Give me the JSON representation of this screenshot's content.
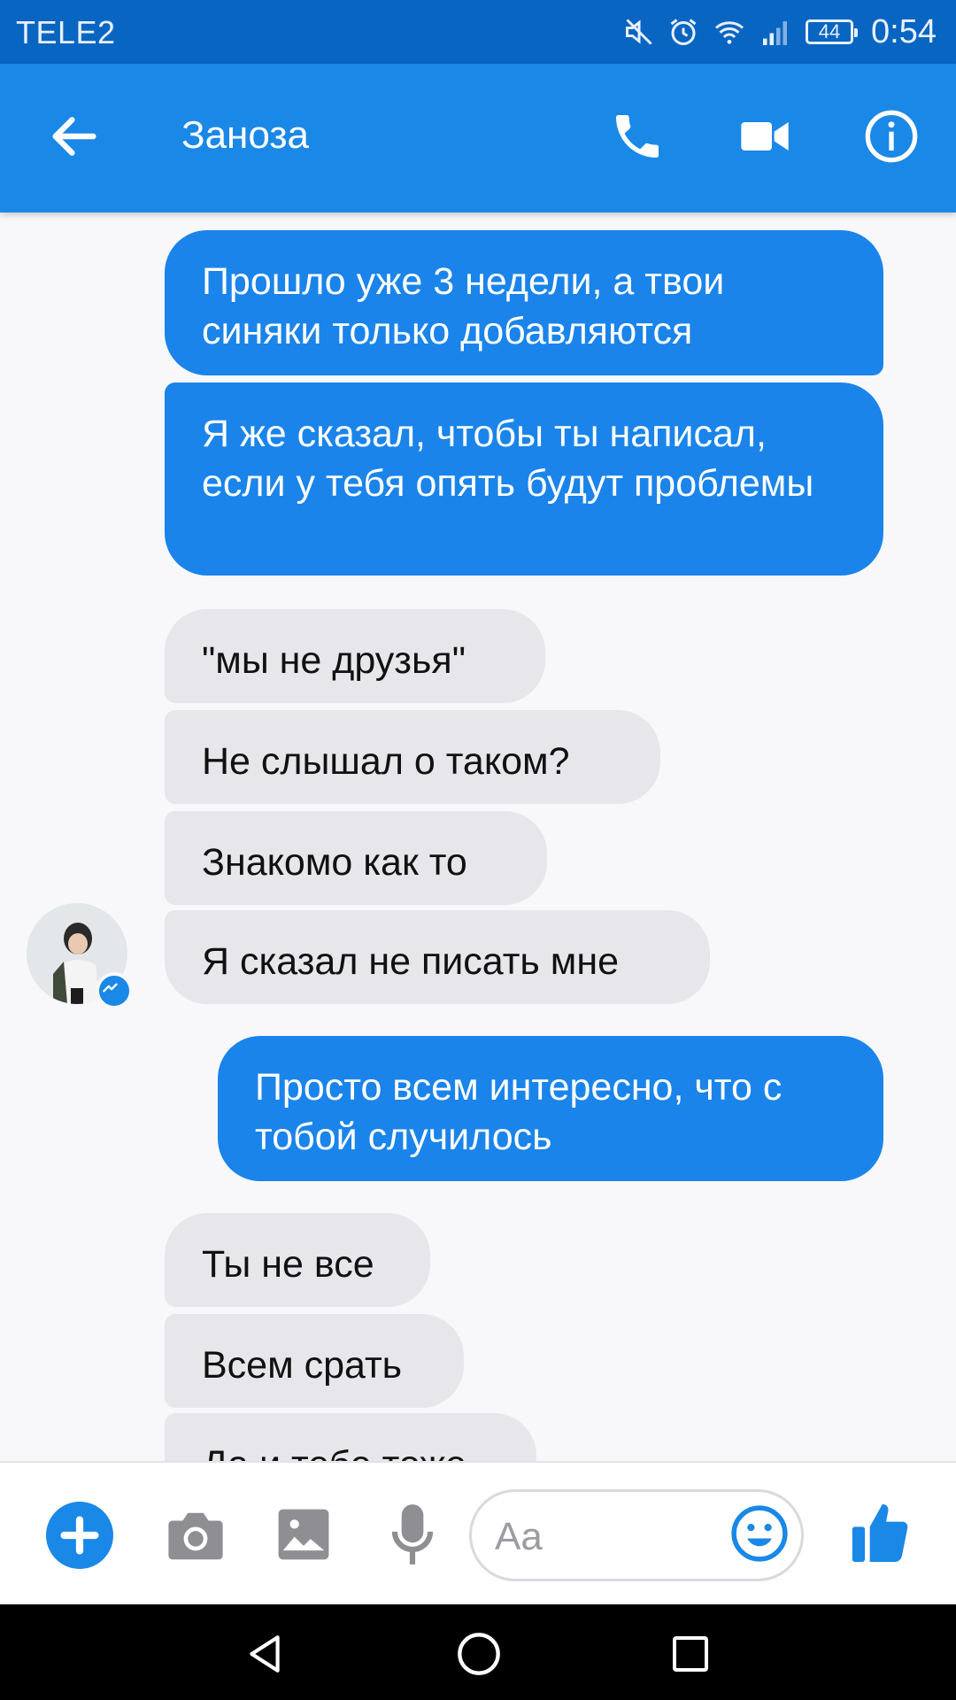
{
  "status_bar": {
    "carrier": "TELE2",
    "battery": "44",
    "time": "0:54",
    "icons": [
      "mute-icon",
      "alarm-icon",
      "wifi-icon",
      "signal-icon",
      "battery-icon"
    ]
  },
  "header": {
    "contact_name": "Заноза",
    "icons": [
      "back-arrow-icon",
      "phone-icon",
      "video-camera-icon",
      "info-icon"
    ]
  },
  "messages": [
    {
      "dir": "out",
      "text": "Прошло уже 3 недели, а твои синяки только добавляются"
    },
    {
      "dir": "out",
      "text": "Я же сказал, чтобы ты написал, если у тебя опять будут проблемы"
    },
    {
      "dir": "in",
      "text": "\"мы не друзья\""
    },
    {
      "dir": "in",
      "text": "Не слышал о таком?"
    },
    {
      "dir": "in",
      "text": "Знакомо как то"
    },
    {
      "dir": "in",
      "text": "Я сказал не писать мне"
    },
    {
      "dir": "out",
      "text": "Просто всем интересно, что с тобой случилось"
    },
    {
      "dir": "in",
      "text": "Ты не все"
    },
    {
      "dir": "in",
      "text": "Всем срать"
    },
    {
      "dir": "in",
      "text": "Да и тебе тоже"
    }
  ],
  "composer": {
    "placeholder": "Aa",
    "icons": [
      "plus-icon",
      "camera-icon",
      "image-icon",
      "microphone-icon",
      "emoji-icon",
      "thumbs-up-icon"
    ]
  },
  "colors": {
    "status_bar": "#0865c2",
    "app_bar": "#1a88e6",
    "outgoing_bubble": "#1a84ea",
    "incoming_bubble": "#e7e6eb",
    "accent": "#1a88e6"
  }
}
